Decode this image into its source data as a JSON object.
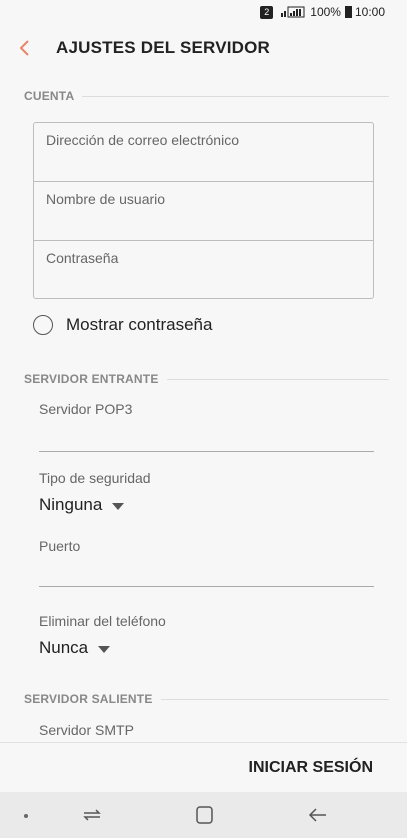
{
  "status_bar": {
    "sim_slot": "2",
    "battery": "100%",
    "time": "10:00"
  },
  "app_bar": {
    "title": "AJUSTES DEL SERVIDOR",
    "back_icon": "chevron-left-icon",
    "accent_color": "#e8866a"
  },
  "account": {
    "header": "CUENTA",
    "email_placeholder": "Dirección de correo electrónico",
    "username_placeholder": "Nombre de usuario",
    "password_placeholder": "Contraseña",
    "show_password_label": "Mostrar contraseña"
  },
  "incoming": {
    "header": "SERVIDOR ENTRANTE",
    "server_label": "Servidor POP3",
    "security_label": "Tipo de seguridad",
    "security_value": "Ninguna",
    "port_label": "Puerto",
    "delete_label": "Eliminar del teléfono",
    "delete_value": "Nunca"
  },
  "outgoing": {
    "header": "SERVIDOR SALIENTE",
    "server_label": "Servidor SMTP"
  },
  "actions": {
    "login_label": "INICIAR SESIÓN"
  },
  "nav_bar": {
    "icons": [
      "recent-apps-icon",
      "home-icon",
      "back-arrow-icon"
    ]
  }
}
